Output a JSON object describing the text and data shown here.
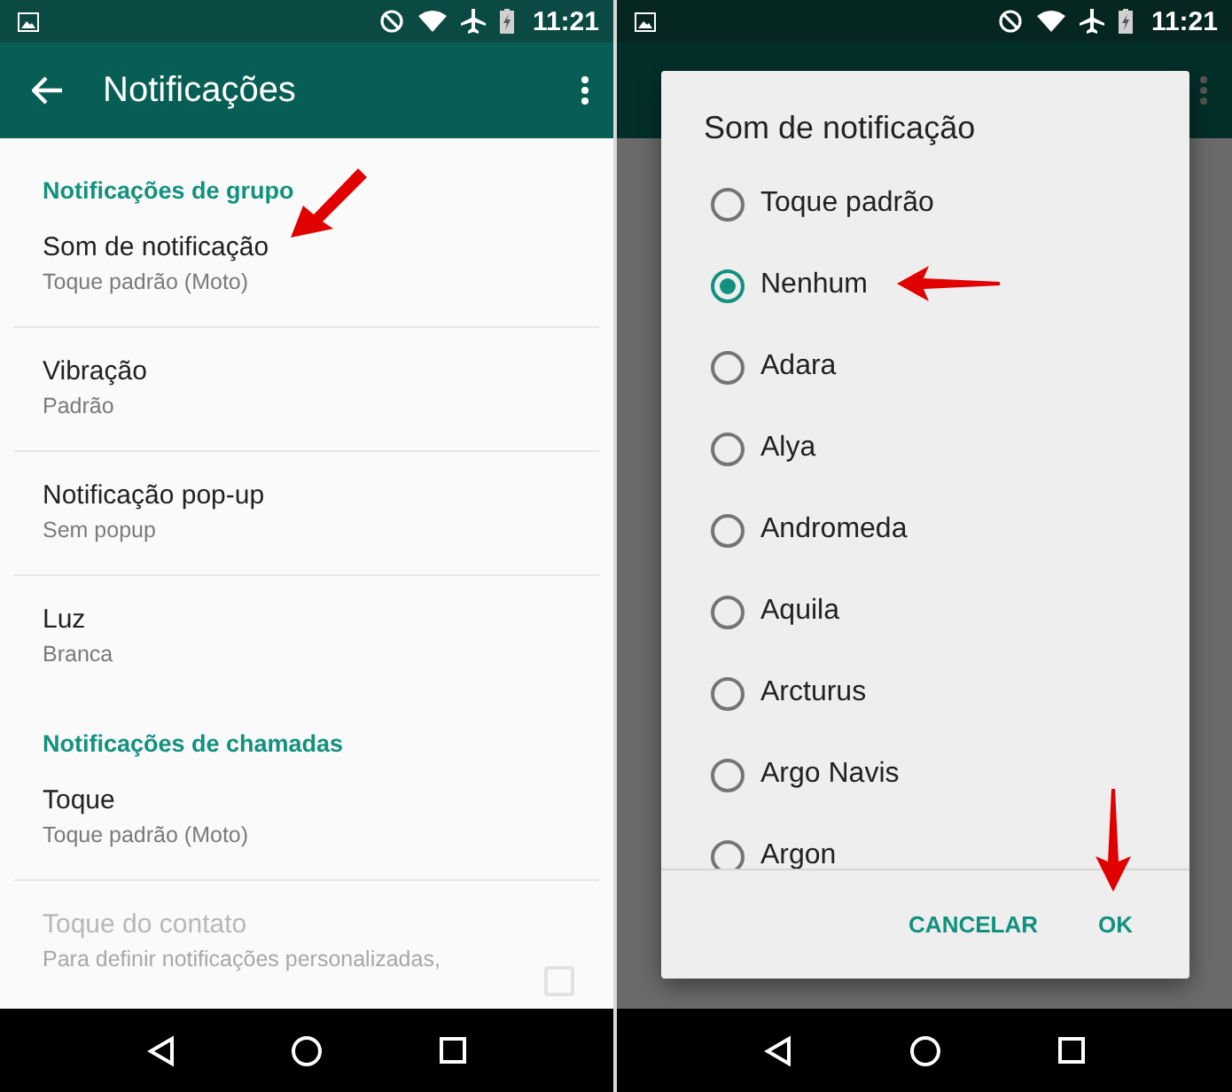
{
  "settings_screen": {
    "status_time": "11:21",
    "title": "Notificações",
    "sections": [
      {
        "header": "Notificações de grupo",
        "items": [
          {
            "kind": "text",
            "title": "Som de notificação",
            "summary": "Toque padrão (Moto)",
            "disabled": false
          },
          {
            "kind": "text",
            "title": "Vibração",
            "summary": "Padrão",
            "disabled": false
          },
          {
            "kind": "text",
            "title": "Notificação pop-up",
            "summary": "Sem popup",
            "disabled": false
          },
          {
            "kind": "text",
            "title": "Luz",
            "summary": "Branca",
            "disabled": false
          }
        ]
      },
      {
        "header": "Notificações de chamadas",
        "items": [
          {
            "kind": "text",
            "title": "Toque",
            "summary": "Toque padrão (Moto)",
            "disabled": false
          },
          {
            "kind": "checkbox",
            "title": "Toque do contato",
            "summary": "Para definir notificações personalizadas,",
            "disabled": true,
            "checked": false
          }
        ]
      }
    ]
  },
  "dialog_screen": {
    "status_time": "11:21",
    "dialog": {
      "title": "Som de notificação",
      "options": [
        {
          "label": "Toque padrão",
          "selected": false
        },
        {
          "label": "Nenhum",
          "selected": true
        },
        {
          "label": "Adara",
          "selected": false
        },
        {
          "label": "Alya",
          "selected": false
        },
        {
          "label": "Andromeda",
          "selected": false
        },
        {
          "label": "Aquila",
          "selected": false
        },
        {
          "label": "Arcturus",
          "selected": false
        },
        {
          "label": "Argo Navis",
          "selected": false
        },
        {
          "label": "Argon",
          "selected": false
        }
      ],
      "buttons": [
        "CANCELAR",
        "OK"
      ]
    }
  }
}
